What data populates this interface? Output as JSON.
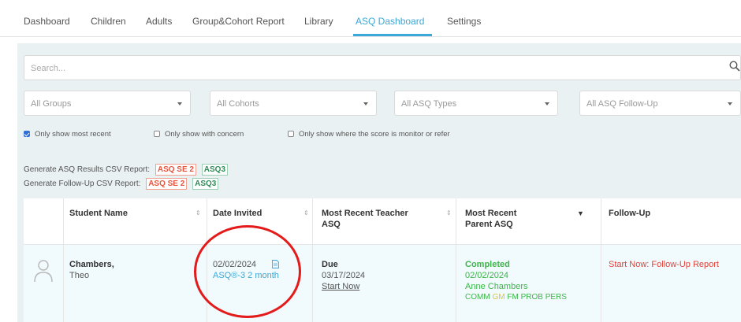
{
  "nav": {
    "tabs": [
      "Dashboard",
      "Children",
      "Adults",
      "Group&Cohort Report",
      "Library",
      "ASQ Dashboard",
      "Settings"
    ],
    "active_tab": "ASQ Dashboard"
  },
  "search": {
    "placeholder": "Search...",
    "icon": "search-icon"
  },
  "filters": [
    "All Groups",
    "All Cohorts",
    "All ASQ Types",
    "All ASQ Follow-Up"
  ],
  "checkboxes": [
    {
      "label": "Only show most recent",
      "checked": true
    },
    {
      "label": "Only show with concern",
      "checked": false
    },
    {
      "label": "Only show where the score is monitor or refer",
      "checked": false
    }
  ],
  "reports": {
    "results_label": "Generate ASQ Results CSV Report:",
    "followup_label": "Generate Follow-Up CSV Report:",
    "logo_se2": "ASQ SE 2",
    "logo_asq3": "ASQ3"
  },
  "table": {
    "headers": {
      "student": "Student Name",
      "date_invited": "Date Invited",
      "teacher": "Most Recent Teacher ASQ",
      "parent": "Most Recent Parent ASQ",
      "followup": "Follow-Up"
    },
    "rows": [
      {
        "last_name": "Chambers,",
        "first_name": "Theo",
        "date_invited": "02/02/2024",
        "asq_type": "ASQ®-3 2 month",
        "teacher_status": "Due",
        "teacher_date": "03/17/2024",
        "teacher_action": "Start Now",
        "parent_status": "Completed",
        "parent_date": "02/02/2024",
        "parent_name": "Anne Chambers",
        "domains": [
          "COMM",
          "GM",
          "FM",
          "PROB",
          "PERS"
        ],
        "followup_action": "Start Now: Follow-Up Report"
      }
    ]
  },
  "colors": {
    "accent": "#3aa8d8",
    "completed": "#3db54a",
    "followup_red": "#e0433a",
    "annotation_circle": "#e41b1b"
  }
}
